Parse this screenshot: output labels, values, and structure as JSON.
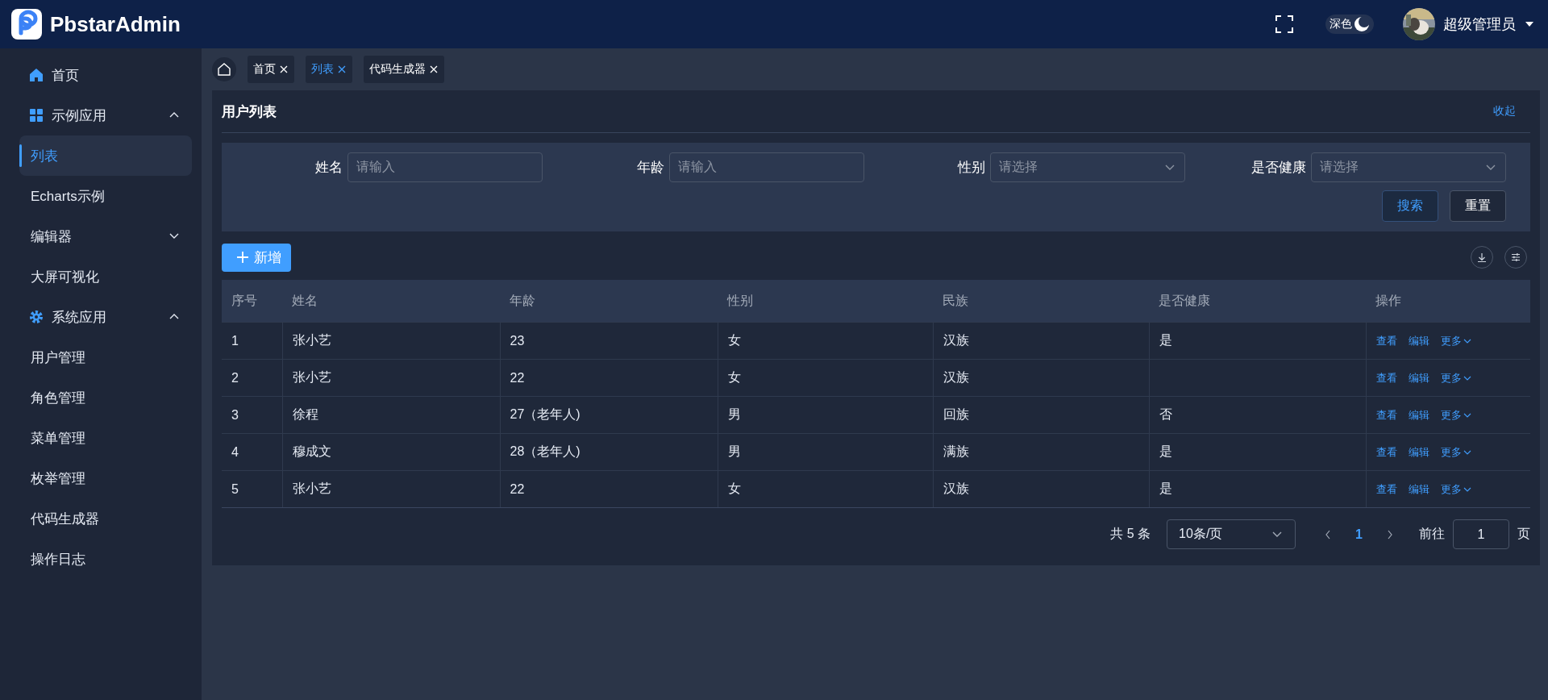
{
  "header": {
    "logo_text": "PbstarAdmin",
    "theme_toggle": {
      "label": "深色",
      "on": true
    },
    "user": {
      "name": "超级管理员"
    }
  },
  "sidebar": {
    "items": [
      {
        "label": "首页",
        "selected": false
      },
      {
        "label": "示例应用",
        "expanded": true,
        "children": [
          {
            "label": "列表",
            "selected": true
          },
          {
            "label": "Echarts示例",
            "selected": false
          },
          {
            "label": "编辑器",
            "expanded": false
          },
          {
            "label": "大屏可视化",
            "selected": false
          }
        ]
      },
      {
        "label": "系统应用",
        "expanded": true,
        "children": [
          {
            "label": "用户管理",
            "selected": false
          },
          {
            "label": "角色管理",
            "selected": false
          },
          {
            "label": "菜单管理",
            "selected": false
          },
          {
            "label": "枚举管理",
            "selected": false
          },
          {
            "label": "代码生成器",
            "selected": false
          },
          {
            "label": "操作日志",
            "selected": false
          }
        ]
      }
    ]
  },
  "tabs": [
    {
      "label": "首页",
      "selected": false
    },
    {
      "label": "列表",
      "selected": true
    },
    {
      "label": "代码生成器",
      "selected": false
    }
  ],
  "card": {
    "title": "用户列表",
    "collapse_link": "收起"
  },
  "filters": [
    {
      "label": "姓名",
      "placeholder": "请输入",
      "kind": "input"
    },
    {
      "label": "年龄",
      "placeholder": "请输入",
      "kind": "input"
    },
    {
      "label": "性别",
      "placeholder": "请选择",
      "kind": "select"
    },
    {
      "label": "是否健康",
      "placeholder": "请选择",
      "kind": "select"
    }
  ],
  "filter_buttons": [
    {
      "label": "搜索",
      "kind": "primary"
    },
    {
      "label": "重置",
      "kind": "plain"
    }
  ],
  "add_button": "新增",
  "table": {
    "columns": [
      "序号",
      "姓名",
      "年龄",
      "性别",
      "民族",
      "是否健康",
      "操作"
    ],
    "rows": [
      {
        "cells": [
          "1",
          "张小艺",
          "23",
          "女",
          "汉族",
          "是"
        ],
        "actions": [
          "查看",
          "编辑",
          "更多"
        ]
      },
      {
        "cells": [
          "2",
          "张小艺",
          "22",
          "女",
          "汉族",
          null
        ],
        "actions": [
          "查看",
          "编辑",
          "更多"
        ]
      },
      {
        "cells": [
          "3",
          "徐程",
          "27（老年人)",
          "男",
          "回族",
          "否"
        ],
        "actions": [
          "查看",
          "编辑",
          "更多"
        ]
      },
      {
        "cells": [
          "4",
          "穆成文",
          "28（老年人)",
          "男",
          "满族",
          "是"
        ],
        "actions": [
          "查看",
          "编辑",
          "更多"
        ]
      },
      {
        "cells": [
          "5",
          "张小艺",
          "22",
          "女",
          "汉族",
          "是"
        ],
        "actions": [
          "查看",
          "编辑",
          "更多"
        ]
      }
    ]
  },
  "pagination": {
    "total": "共 5 条",
    "page_size": "10条/页",
    "pages": [
      {
        "label": "1",
        "selected": true
      }
    ],
    "goto_label": "前往",
    "goto_value": "1",
    "goto_suffix": "页"
  }
}
